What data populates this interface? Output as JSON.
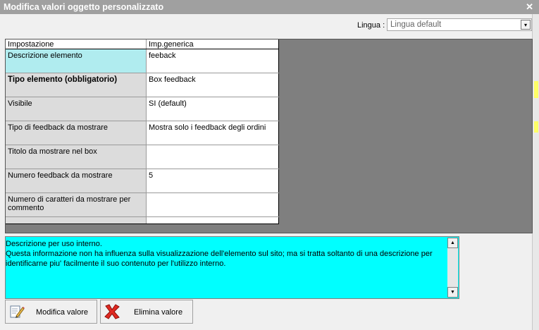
{
  "window": {
    "title": "Modifica valori oggetto personalizzato",
    "close_glyph": "✕"
  },
  "language": {
    "label": "Lingua :",
    "selected": "Lingua default",
    "arrow": "▾"
  },
  "table": {
    "headers": [
      "Impostazione",
      "Imp.generica"
    ],
    "rows": [
      {
        "key": "Descrizione elemento",
        "value": "feeback"
      },
      {
        "key": "Tipo elemento (obbligatorio)",
        "value": "Box feedback"
      },
      {
        "key": "Visibile",
        "value": "SI (default)"
      },
      {
        "key": "Tipo di feedback da mostrare",
        "value": "Mostra solo i feedback degli ordini"
      },
      {
        "key": "Titolo da mostrare nel box",
        "value": ""
      },
      {
        "key": "Numero feedback da mostrare",
        "value": "5"
      },
      {
        "key": "Numero di caratteri da mostrare per commento",
        "value": ""
      }
    ]
  },
  "description": {
    "text": "Descrizione per uso interno.\nQuesta informazione non ha influenza sulla visualizzazione dell'elemento sul sito; ma si tratta soltanto di una descrizione per identificarne piu' facilmente il suo contenuto per l'utilizzo interno.",
    "scroll_up": "▲",
    "scroll_down": "▼"
  },
  "buttons": {
    "modify": "Modifica valore",
    "delete": "Elimina valore"
  },
  "colors": {
    "titlebar": "#a0a0a0",
    "selected_cell": "#b0ecef",
    "description_bg": "#00ffff",
    "grid_bg": "#7f7f7f"
  }
}
